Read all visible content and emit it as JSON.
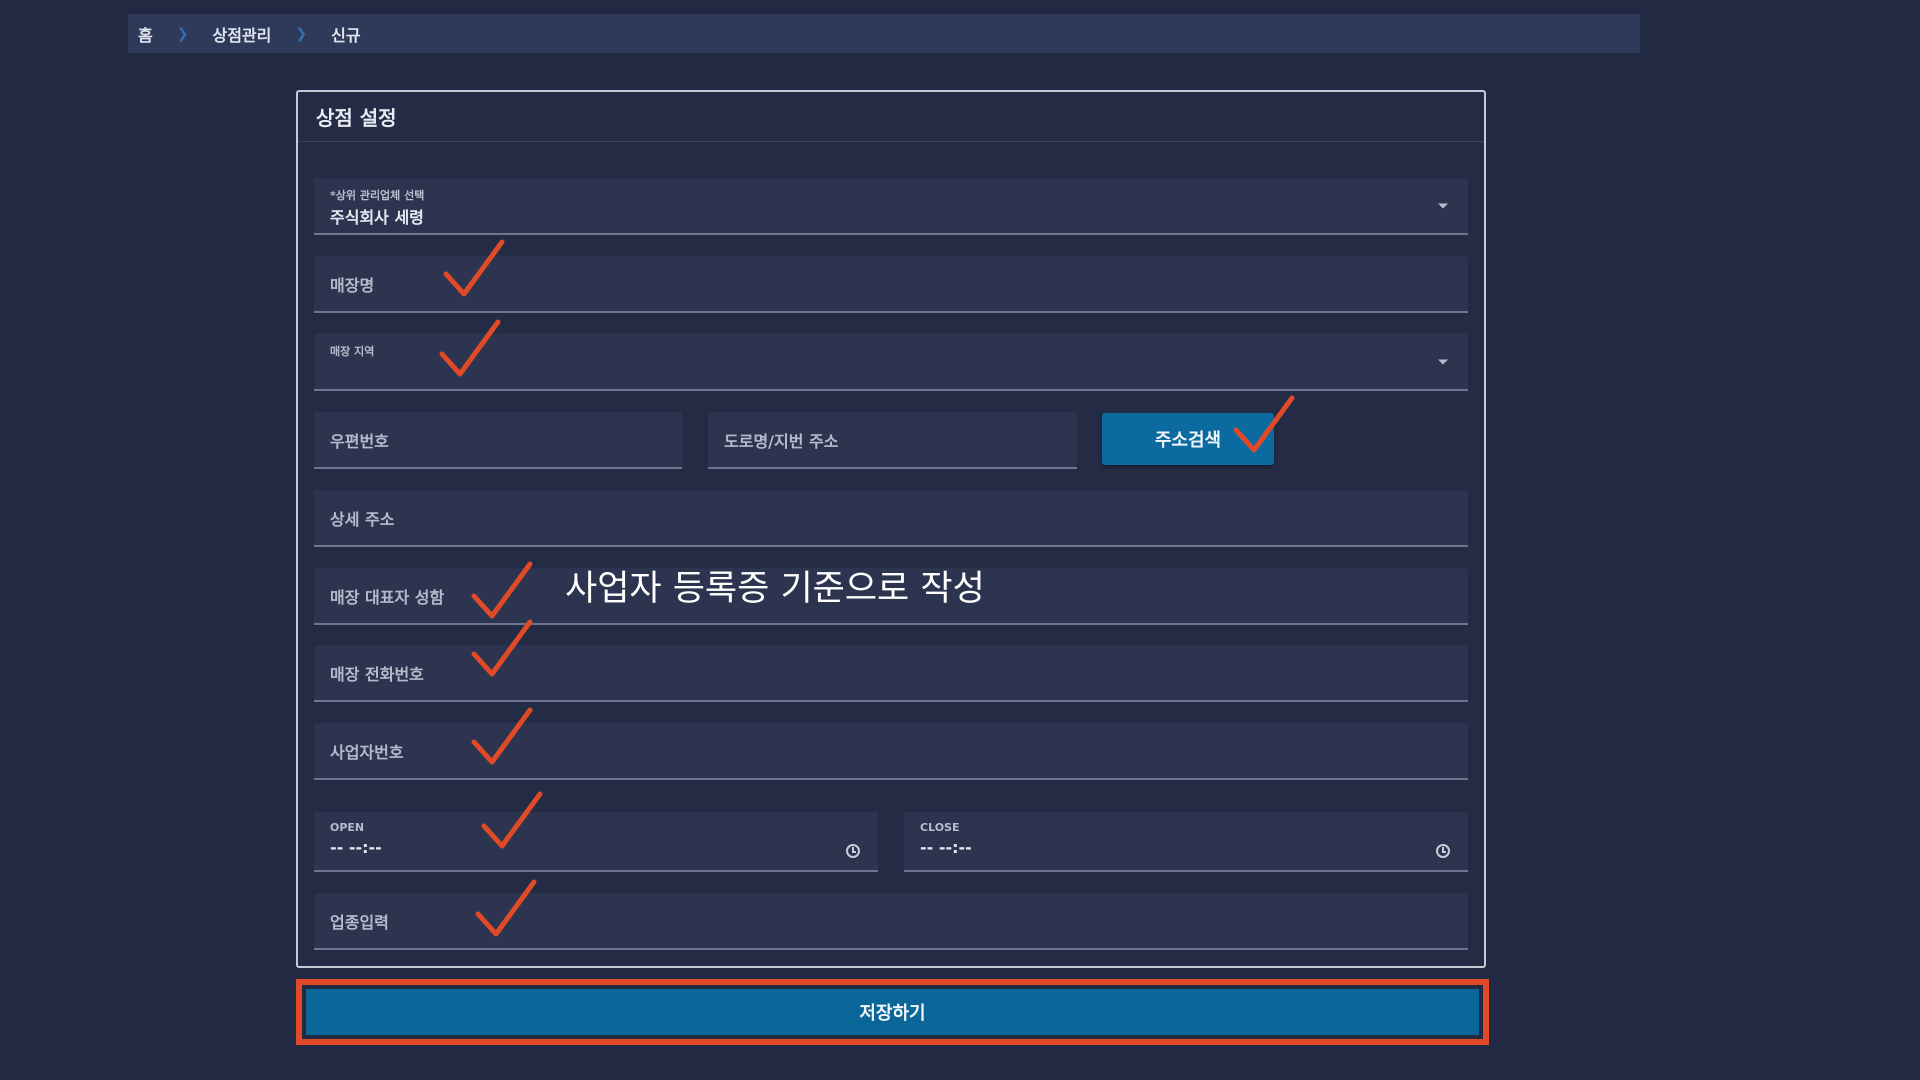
{
  "breadcrumb": {
    "home": "홈",
    "section": "상점관리",
    "current": "신규"
  },
  "card": {
    "title": "상점 설정"
  },
  "fields": {
    "parent_company": {
      "label": "*상위 관리업체 선택",
      "value": "주식회사 세령"
    },
    "store_name": {
      "label": "매장명"
    },
    "store_region": {
      "label": "매장 지역"
    },
    "postal_code": {
      "label": "우편번호"
    },
    "road_address": {
      "label": "도로명/지번 주소"
    },
    "address_search": {
      "label": "주소검색"
    },
    "detail_address": {
      "label": "상세 주소"
    },
    "representative": {
      "label": "매장 대표자 성함"
    },
    "phone": {
      "label": "매장 전화번호"
    },
    "business_number": {
      "label": "사업자번호"
    },
    "open": {
      "label": "OPEN",
      "value": "-- --:--"
    },
    "close": {
      "label": "CLOSE",
      "value": "-- --:--"
    },
    "business_type": {
      "label": "업종입력"
    }
  },
  "annotation": {
    "text": "사업자 등록증 기준으로 작성",
    "color": "#e04a27"
  },
  "save": {
    "label": "저장하기"
  },
  "colors": {
    "background": "#222a43",
    "primary": "#0b6aa0",
    "annotation": "#e04a27"
  }
}
